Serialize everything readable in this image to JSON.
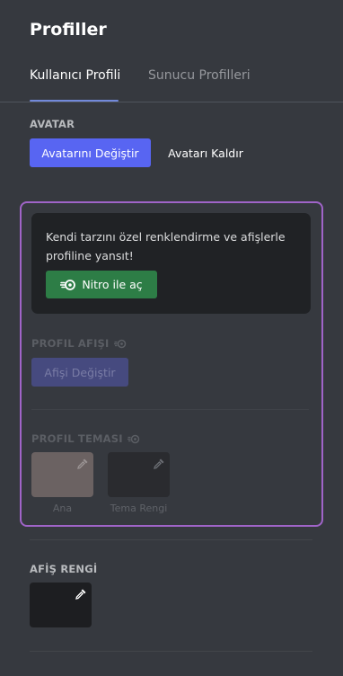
{
  "page": {
    "title": "Profiller"
  },
  "tabs": [
    {
      "label": "Kullanıcı Profili",
      "active": true
    },
    {
      "label": "Sunucu Profilleri",
      "active": false
    }
  ],
  "avatar": {
    "label": "AVATAR",
    "change_label": "Avatarını Değiştir",
    "remove_label": "Avatarı Kaldır"
  },
  "nitro_upsell": {
    "text": "Kendi tarzını özel renklendirme ve afişlerle profiline yansıt!",
    "button_label": "Nitro ile aç"
  },
  "profile_banner": {
    "label": "PROFIL AFIŞI",
    "button_label": "Afişi Değiştir"
  },
  "profile_theme": {
    "label": "PROFIL TEMASI",
    "primary_caption": "Ana",
    "accent_caption": "Tema Rengi",
    "primary_color": "#6b6262",
    "accent_color": "#2a2b2f"
  },
  "banner_color": {
    "label": "AFİŞ RENGİ",
    "color": "#1d1e21"
  },
  "colors": {
    "background": "#36393f",
    "brand": "#5865f2",
    "nitro_green": "#2d7d46",
    "nitro_border": "#a064c8"
  }
}
